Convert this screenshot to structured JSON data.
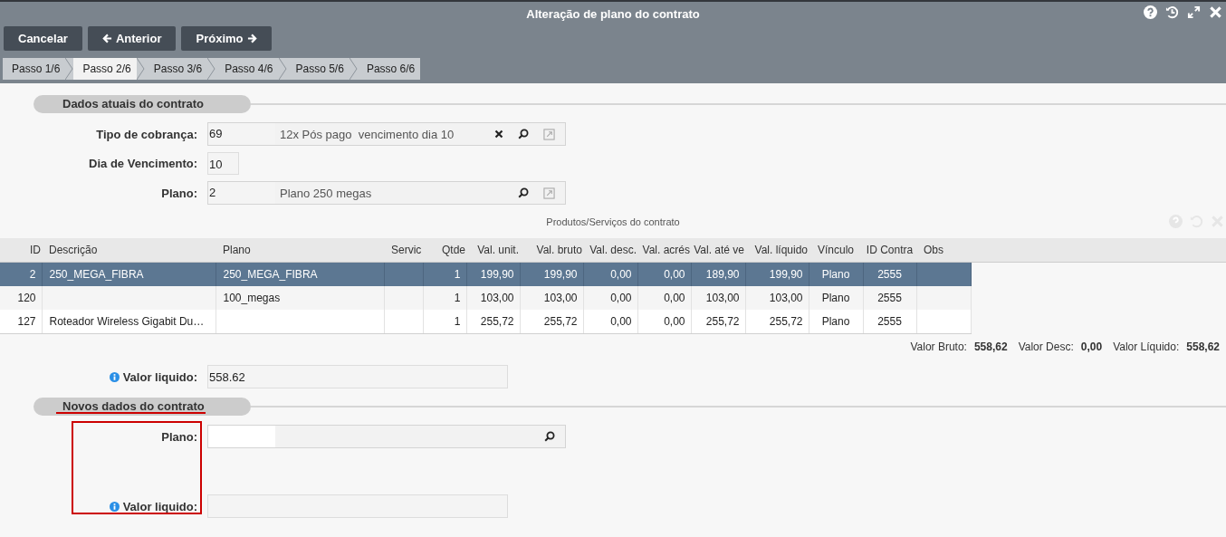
{
  "window": {
    "title": "Alteração de plano do contrato"
  },
  "buttons": [
    {
      "label": "Cancelar",
      "kind": "plain"
    },
    {
      "label": "Anterior",
      "kind": "back"
    },
    {
      "label": "Próximo",
      "kind": "next"
    }
  ],
  "steps": [
    {
      "label": "Passo 1/6",
      "selected": false
    },
    {
      "label": "Passo 2/6",
      "selected": true
    },
    {
      "label": "Passo 3/6",
      "selected": false
    },
    {
      "label": "Passo 4/6",
      "selected": false
    },
    {
      "label": "Passo 5/6",
      "selected": false
    },
    {
      "label": "Passo 6/6",
      "selected": false
    }
  ],
  "current": {
    "title": "Dados atuais do contrato",
    "fields": [
      {
        "label": "Tipo de cobrança:",
        "kind": "lookup",
        "code": "69",
        "description": "12x Pós pago  vencimento dia 10",
        "clearable": true,
        "openable": true
      },
      {
        "label": "Dia de Vencimento:",
        "kind": "short",
        "value": "10"
      },
      {
        "label": "Plano:",
        "kind": "lookup",
        "code": "2",
        "description": "Plano 250 megas",
        "clearable": false,
        "openable": true
      }
    ]
  },
  "products": {
    "title": "Produtos/Serviços do contrato",
    "columns": [
      "ID",
      "Descrição",
      "Plano",
      "Servic",
      "Qtde",
      "Val. unit.",
      "Val. bruto",
      "Val. desc.",
      "Val. acrés",
      "Val. até ve",
      "Val. líquido",
      "Vínculo",
      "ID Contra",
      "Obs"
    ],
    "rows": [
      {
        "selected": true,
        "cells": [
          "2",
          "250_MEGA_FIBRA",
          "250_MEGA_FIBRA",
          "",
          "1",
          "199,90",
          "199,90",
          "0,00",
          "0,00",
          "189,90",
          "199,90",
          "Plano",
          "2555",
          ""
        ]
      },
      {
        "selected": false,
        "cells": [
          "120",
          "",
          "100_megas",
          "",
          "1",
          "103,00",
          "103,00",
          "0,00",
          "0,00",
          "103,00",
          "103,00",
          "Plano",
          "2555",
          ""
        ]
      },
      {
        "selected": false,
        "cells": [
          "127",
          "Roteador Wireless Gigabit Du…",
          "",
          "",
          "1",
          "255,72",
          "255,72",
          "0,00",
          "0,00",
          "255,72",
          "255,72",
          "Plano",
          "2555",
          ""
        ]
      }
    ],
    "totals": [
      {
        "label": "Valor Bruto:",
        "value": "558,62"
      },
      {
        "label": "Valor Desc:",
        "value": "0,00"
      },
      {
        "label": "Valor Líquido:",
        "value": "558,62"
      }
    ]
  },
  "current_net": {
    "label": "Valor liquido:",
    "info": true,
    "kind": "text",
    "value": "558.62"
  },
  "new": {
    "title": "Novos dados do contrato",
    "annotated": true,
    "fields": [
      {
        "label": "Plano:",
        "kind": "lookup",
        "clearable": false,
        "openable": false
      },
      {
        "label": "Valor liquido:",
        "info": true,
        "kind": "text"
      }
    ]
  }
}
